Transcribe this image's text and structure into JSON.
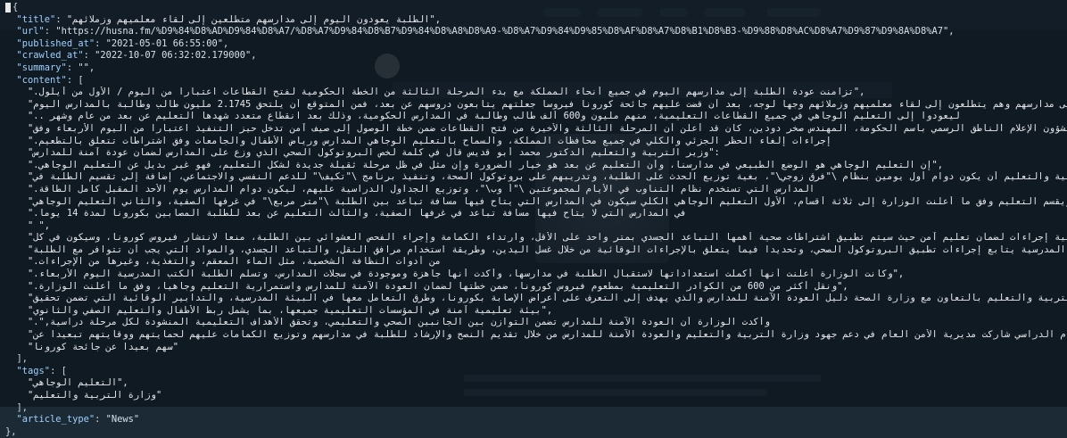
{
  "json_doc": {
    "open": "{",
    "close": "},",
    "cursor": "[",
    "fields": {
      "title_key": "\"title\"",
      "title_value": "\"الطلبة يعودون اليوم إلى مدارسهم متطلعين إلى لقاء معلميهم وزملائهم\",",
      "url_key": "\"url\"",
      "url_value": "\"https://husna.fm/%D9%84%D8%AD%D9%84%D8%A7/%D8%A7%D9%84%D8%B7%D9%84%D8%A8%D8%A9-%D8%A7%D9%84%D9%85%D8%AF%D8%A7%D8%B1%D8%B3-%D9%88%D8%AC%D8%A7%D9%87%D9%8A%D8%A7\",",
      "published_key": "\"published_at\"",
      "published_value": "\"2021-05-01 66:55:00\",",
      "crawled_key": "\"crawled_at\"",
      "crawled_value": "\"2022-10-07 06:32:02.179000\",",
      "summary_key": "\"summary\"",
      "summary_value": "\"\",",
      "content_key": "\"content\"",
      "content_open": "[",
      "content_close": "],",
      "tags_key": "\"tags\"",
      "tags_open": "[",
      "tags_close": "],",
      "article_type_key": "\"article_type\"",
      "article_type_value": "\"News\""
    },
    "content": [
      "\".تزامنت عودة الطلبة إلى مدارسهم اليوم في جميع أنحاء المملكة مع بدء المرحلة الثالثة من الخطة الحكومية لفتح القطاعات اعتبارا من اليوم / الأول من أيلول\",",
      "\"اليوم يعود الطلبة إلى مدارسهم وهم يتطلعون إلى لقاء معلميهم وزملائهم وجها لوجه، بعد أن قضت عليهم جائحة كورونا فيروسا جعلتهم يتابعون دروسهم عن بعد، فمن المتوقع أن يلتحق 2.1745 مليون طالب وطالبة بالمدارس اليوم",
      "\".. ليعودوا إلى التعليم الوجاهي في جميع القطاعات التعليمية، منهم مليون و600 ألف طالب وطالبة في المدارس الحكومية، وذلك بعد انقطاع متعدد شهدها التعليم عن بعد من عام وشهر",
      "\"وزير الدولة لشؤون الإعلام الناطق الرسمي باسم الحكومة، المهندس صخر دودين، كان قد أعلن أن المرحلة الثالثة والأخيرة من فتح القطاعات ضمن خطة الوصول إلى صيف آمن تدخل حيز التنفيذ اعتبارا من اليوم الأربعاء وفق",
      "\".إجراءات إلغاء الحظر الجزئي والكلي في جميع محافظات المملكة، والسماح بالتعليم الوجاهي المدارس ورياض الأطفال والجامعات وفق اشتراطات تتعلق بالتطعيم",
      "\"وزير التربية والتعليم الدكتور محمد أبو قديس قال في كلمة لخص البروتوكول الصحي الذي وزع على المدارس لضمان عودة آمنة للمدارس\":",
      "\".إن التعليم الوجاهي هو الوضع الطبيعي في مدارسنا، وأن التعليم عن بعد هو خيار الضرورة وإن مثل في ظل مرحلة ثقيلة جديدة لشكل التعليم، فهو غير بديل عن التعليم الوجاهي\",",
      "\"وقررت وزارة التربية والتعليم أن يكون دوام أول يومين بنظام \\\"فرق زوجي\\\"، بغية توزيع الحدث على الطلبة، وتدريبهم على بروتوكول الصحة، وتنفيذ برنامج \\\"تكيف\\\" للدعم النفسي والاجتماعي، إضافة إلى تقسيم الطلبة في",
      "\".المدارس التي تستخدم نظام التناوب في الأيام لمجموعتين \\\"أ وب\\\"، وتوزيع الجداول الدراسية عليهم، ليكون دوام المدارس يوم الأحد المقبل كامل الطاقة",
      "\"ويقسم التعليم وفق ما أعلنت الوزارة إلى ثلاثة أقسام، الأول التعليم الوجاهي الكلي سيكون في المدارس التي يتاح فيها مسافة تباعد بين الطلبة \\\"متر مربع\\\" في غرفها الصفية، والثاني التعليم الوجاهي",
      "\".في المدارس التي لا يتاح فيها مسافة تباعد في غرفها الصفية، والثالث التعليم عن بعد للطلبة المصابين بكورونا لمدة 14 يوما",
      "\" \",",
      "\"وتتبع وزارة التربية إجراءات لضمان تعليم آمن حيث سيتم تطبيق اشتراطات صحية أهمها التباعد الجسدي بمتر واحد على الأقل، وارتداء الكمامة وإجراء الفحص العشوائي بين الطلبة، منعا لانتشار فيروس كورونا، وسيكون في كل",
      "\"مدرسة معلم مسؤول عن الصحة المدرسية يتابع إجراءات تطبيق البروتوكول الصحي، وتحديدا فيما يتعلق بالإجراءات الوقائية من خلال غسل اليدين، وطريقة استخدام مرافق النقل، والتباعد الجسدي، والمواد التي يجب أن تتوافر مع الطلبة",
      "\".من أدوات النظافة الشخصية، مثل الماء المعقم، والتغذية، وغيرها من الإجراءات",
      "\".وكانت الوزارة أعلنت أنها أكملت استعداداتها لاستقبال الطلبة في مدارسها، وأكدت أنها جاهزة وموجودة في سجلات المدارس، وتسلم الطلبة الكتب المدرسية اليوم الأربعاء\",",
      "\".ونقل أكثر من 600 من الكوادر التعليمية بمطعوم فيروس كورونا، ضمن خطتها لضمان العودة الآمنة للمدارس واستمرارية التعليم وجاهيا، وفق ما أعلنت الوزارة\",",
      "\"وشددت وزارة التربية والتعليم بالتعاون مع وزارة الصحة دليل العودة الآمنة للمدارس والذي يهدف إلى التعرف على أعراض الإصابة بكورونا، وطرق التعامل معها في البيئة المدرسية، والتدابير الوقائية التي تضمن تحقيق",
      "\"بيئة تعليمية آمنة في المؤسسات التعليمية جميعها، بما يشمل ربط الأطفال والتعليم الصفي والثانوي\",",
      "\".\",وأكدت الوزارة أن العودة الآمنة للمدارس تضمن التوازن بين الجانبين الصحي والتعليمي، وتحقق الأهداف التعليمية المنشودة لكل مرحلة دراسية",
      "\"ومع بدء العام الدراسي شاركت مديرية الأمن العام في دعم جهود وزارة التربية والتعليم والعودة الآمنة للمدارس من خلال تقديم النصح والإرشاد للطلبة في مدارسهم وتوزيع الكمامات عليهم لحمايتهم ووقايتهم تبعيدا عن",
      "\"سهم بعيدا عن جائحة كورونا\""
    ],
    "tags": [
      "\"التعليم الوجاهي\",",
      "\"وزارة التربية والتعليم\""
    ]
  }
}
